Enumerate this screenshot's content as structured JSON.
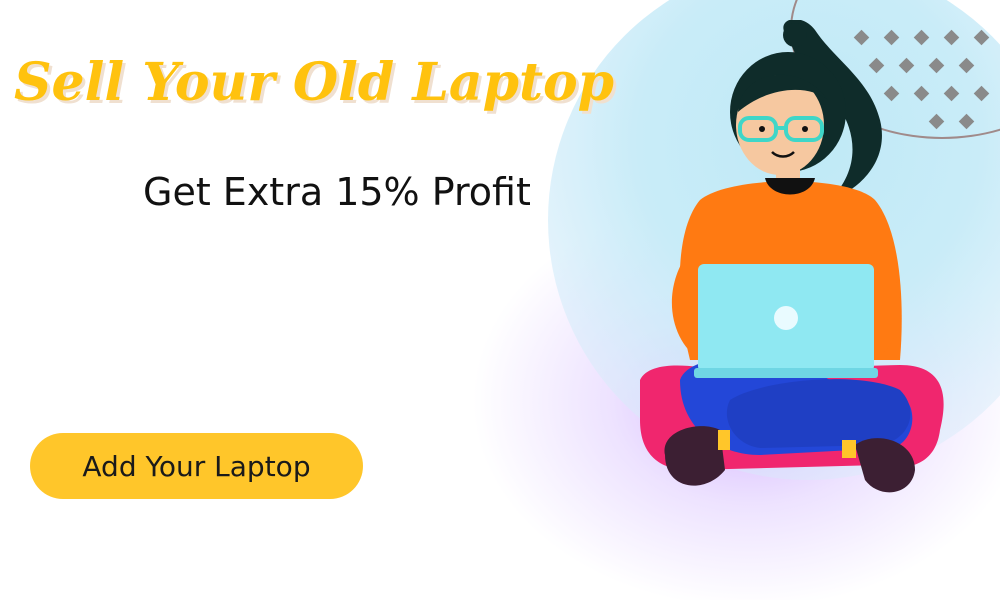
{
  "banner": {
    "headline": "Sell Your Old Laptop",
    "subheadline": "Get Extra 15% Profit",
    "cta_label": "Add Your Laptop"
  },
  "colors": {
    "headline": "#ffc20e",
    "cta_background": "#ffc62a",
    "sweater": "#ff7a12",
    "laptop": "#8fe8f2",
    "pants": "#2347d8",
    "cushion": "#f0266e",
    "background_circle": "#c3e9f7"
  },
  "icons": {
    "illustration": "woman-with-laptop-illustration",
    "pattern": "diamond-dot-pattern"
  }
}
